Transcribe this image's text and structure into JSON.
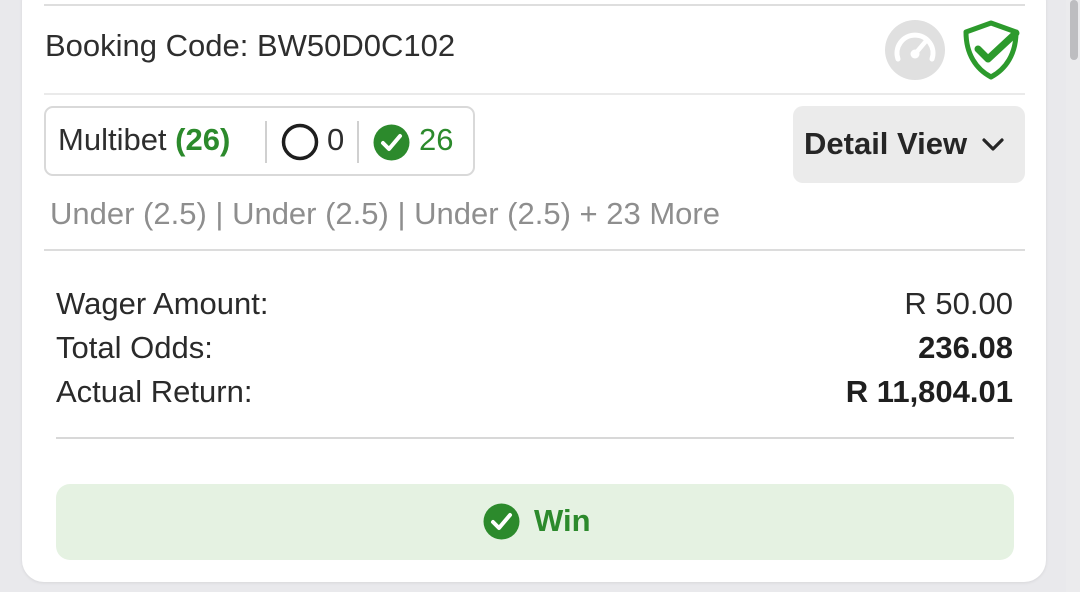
{
  "booking": {
    "label": "Booking Code:",
    "code": "BW50D0C102"
  },
  "summary": {
    "type_label": "Multibet",
    "leg_count": "(26)",
    "open_count": "0",
    "won_count": "26"
  },
  "detail_button": {
    "label": "Detail View"
  },
  "selections_text": "Under (2.5) | Under (2.5) | Under (2.5) + 23 More",
  "amounts": {
    "wager_label": "Wager Amount:",
    "wager_value": "R 50.00",
    "odds_label": "Total Odds:",
    "odds_value": "236.08",
    "return_label": "Actual Return:",
    "return_value": "R 11,804.01"
  },
  "result": {
    "label": "Win"
  },
  "colors": {
    "accent_green": "#2c8a2c",
    "win_background": "#e5f2e2",
    "icon_grey": "#e0e0e0"
  },
  "icons": [
    "speedometer-icon",
    "shield-check-icon",
    "open-circle-icon",
    "check-circle-icon",
    "chevron-down-icon"
  ]
}
